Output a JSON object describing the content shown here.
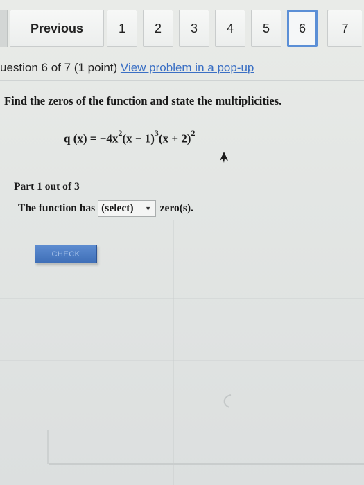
{
  "nav": {
    "previous_label": "Previous",
    "pages": [
      "1",
      "2",
      "3",
      "4",
      "5",
      "6",
      "7"
    ],
    "active_page": "6"
  },
  "question": {
    "header": "uestion 6 of 7 (1 point)",
    "popup_link": "View problem in a pop-up",
    "instruction": "Find the zeros of the function and state the multiplicities.",
    "function": {
      "lhs": "q (x) = ",
      "coef": "−4x",
      "exp1": "2",
      "f2": "(x  − 1)",
      "exp2": "3",
      "f3": "(x  + 2)",
      "exp3": "2"
    }
  },
  "part": {
    "label": "Part 1 out of 3",
    "sentence_before": "The function has",
    "select_value": "(select)",
    "sentence_after": "zero(s)."
  },
  "check_button": "CHECK",
  "colors": {
    "active_border": "#5b8fd6",
    "link": "#3a6fc4",
    "check_bg": "#4a7cc4"
  }
}
